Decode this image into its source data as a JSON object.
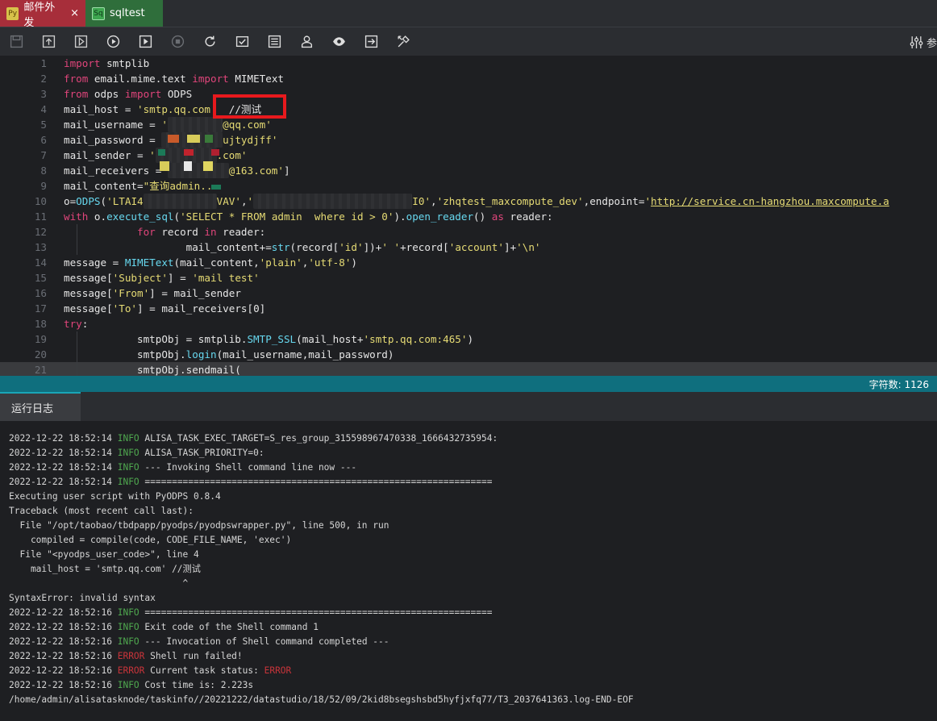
{
  "tabs": [
    {
      "icon": "Py",
      "label": "邮件外发",
      "close": "×"
    },
    {
      "icon": "Sq",
      "label": "sqltest"
    }
  ],
  "toolbar": {
    "right_label": "参"
  },
  "editor": {
    "lines": [
      {
        "n": "1",
        "parts": [
          [
            "kw",
            "import"
          ],
          [
            "",
            " smtplib"
          ]
        ]
      },
      {
        "n": "2",
        "parts": [
          [
            "kw",
            "from"
          ],
          [
            "",
            " email.mime.text "
          ],
          [
            "kw",
            "import"
          ],
          [
            "",
            " MIMEText"
          ]
        ]
      },
      {
        "n": "3",
        "parts": [
          [
            "kw",
            "from"
          ],
          [
            "",
            " odps "
          ],
          [
            "kw",
            "import"
          ],
          [
            "",
            " ODPS"
          ]
        ]
      },
      {
        "n": "4",
        "parts": [
          [
            "",
            "mail_host = "
          ],
          [
            "str",
            "'smtp.qq.com'"
          ],
          [
            "",
            "  //测试"
          ]
        ]
      },
      {
        "n": "5",
        "parts": [
          [
            "",
            "mail_username = "
          ],
          [
            "str",
            "'"
          ],
          [
            "blur",
            "         "
          ],
          [
            "str",
            "@qq.com'"
          ]
        ]
      },
      {
        "n": "6",
        "parts": [
          [
            "",
            "mail_password = "
          ],
          [
            "blur",
            "          "
          ],
          [
            "str",
            "ujtydjff'"
          ]
        ]
      },
      {
        "n": "7",
        "parts": [
          [
            "",
            "mail_sender = "
          ],
          [
            "str",
            "'"
          ],
          [
            "blur",
            "          "
          ],
          [
            "str",
            ".com'"
          ]
        ]
      },
      {
        "n": "8",
        "parts": [
          [
            "",
            "mail_receivers = "
          ],
          [
            "blur",
            "          "
          ],
          [
            "str",
            "@163.com'"
          ],
          [
            "",
            "]"
          ]
        ]
      },
      {
        "n": "9",
        "parts": [
          [
            "",
            "mail_content="
          ],
          [
            "str",
            "\"查询admin..."
          ]
        ]
      },
      {
        "n": "10",
        "parts": [
          [
            "",
            "o="
          ],
          [
            "fn",
            "ODPS"
          ],
          [
            "",
            "("
          ],
          [
            "str",
            "'LTAI4"
          ],
          [
            "blur",
            "            "
          ],
          [
            "str",
            "VAV'"
          ],
          [
            "",
            ","
          ],
          [
            "str",
            "'"
          ],
          [
            "blur",
            "                          "
          ],
          [
            "str",
            "I0'"
          ],
          [
            "",
            ","
          ],
          [
            "str",
            "'zhqtest_maxcompute_dev'"
          ],
          [
            "",
            ",endpoint="
          ],
          [
            "str",
            "'"
          ],
          [
            "url",
            "http://service.cn-hangzhou.maxcompute.a"
          ]
        ]
      },
      {
        "n": "11",
        "parts": [
          [
            "kw",
            "with"
          ],
          [
            "",
            " o."
          ],
          [
            "fn",
            "execute_sql"
          ],
          [
            "",
            "("
          ],
          [
            "str",
            "'SELECT * FROM admin  where id > 0'"
          ],
          [
            "",
            ")."
          ],
          [
            "fn",
            "open_reader"
          ],
          [
            "",
            "() "
          ],
          [
            "kw",
            "as"
          ],
          [
            "",
            " reader:"
          ]
        ]
      },
      {
        "n": "12",
        "parts": [
          [
            "",
            "            "
          ],
          [
            "kw",
            "for"
          ],
          [
            "",
            " record "
          ],
          [
            "kw",
            "in"
          ],
          [
            "",
            " reader:"
          ]
        ]
      },
      {
        "n": "13",
        "parts": [
          [
            "",
            "                    mail_content+="
          ],
          [
            "fn",
            "str"
          ],
          [
            "",
            "(record["
          ],
          [
            "str",
            "'id'"
          ],
          [
            "",
            "])+"
          ],
          [
            "str",
            "' '"
          ],
          [
            "",
            "+record["
          ],
          [
            "str",
            "'account'"
          ],
          [
            "",
            "]+"
          ],
          [
            "str",
            "'\\n'"
          ]
        ]
      },
      {
        "n": "14",
        "parts": [
          [
            "",
            "message = "
          ],
          [
            "fn",
            "MIMEText"
          ],
          [
            "",
            "(mail_content,"
          ],
          [
            "str",
            "'plain'"
          ],
          [
            "",
            ","
          ],
          [
            "str",
            "'utf-8'"
          ],
          [
            "",
            ")"
          ]
        ]
      },
      {
        "n": "15",
        "parts": [
          [
            "",
            "message["
          ],
          [
            "str",
            "'Subject'"
          ],
          [
            "",
            "] = "
          ],
          [
            "str",
            "'mail test'"
          ]
        ]
      },
      {
        "n": "16",
        "parts": [
          [
            "",
            "message["
          ],
          [
            "str",
            "'From'"
          ],
          [
            "",
            "] = mail_sender"
          ]
        ]
      },
      {
        "n": "17",
        "parts": [
          [
            "",
            "message["
          ],
          [
            "str",
            "'To'"
          ],
          [
            "",
            "] = mail_receivers[0]"
          ]
        ]
      },
      {
        "n": "18",
        "parts": [
          [
            "kw",
            "try"
          ],
          [
            "",
            ":"
          ]
        ]
      },
      {
        "n": "19",
        "parts": [
          [
            "",
            "            smtpObj = smtplib."
          ],
          [
            "fn",
            "SMTP_SSL"
          ],
          [
            "",
            "(mail_host+"
          ],
          [
            "str",
            "'smtp.qq.com:465'"
          ],
          [
            "",
            ")"
          ]
        ]
      },
      {
        "n": "20",
        "parts": [
          [
            "",
            "            smtpObj."
          ],
          [
            "fn",
            "login"
          ],
          [
            "",
            "(mail_username,mail_password)"
          ]
        ]
      },
      {
        "n": "21",
        "parts": [
          [
            "",
            "            smtpObj.sendmail("
          ]
        ]
      }
    ]
  },
  "status": {
    "char_count": "字符数: 1126"
  },
  "log": {
    "tab_label": "运行日志",
    "lines": [
      {
        "ts": "2022-12-22 18:52:14 ",
        "lvl": "INFO",
        "msg": " ALISA_TASK_EXEC_TARGET=S_res_group_315598967470338_1666432735954:"
      },
      {
        "ts": "2022-12-22 18:52:14 ",
        "lvl": "INFO",
        "msg": " ALISA_TASK_PRIORITY=0:"
      },
      {
        "ts": "2022-12-22 18:52:14 ",
        "lvl": "INFO",
        "msg": " --- Invoking Shell command line now ---"
      },
      {
        "ts": "2022-12-22 18:52:14 ",
        "lvl": "INFO",
        "msg": " ================================================================"
      },
      {
        "ts": "",
        "lvl": "",
        "msg": "Executing user script with PyODPS 0.8.4"
      },
      {
        "ts": "",
        "lvl": "",
        "msg": "Traceback (most recent call last):"
      },
      {
        "ts": "",
        "lvl": "",
        "msg": "  File \"/opt/taobao/tbdpapp/pyodps/pyodpswrapper.py\", line 500, in run"
      },
      {
        "ts": "",
        "lvl": "",
        "msg": "    compiled = compile(code, CODE_FILE_NAME, 'exec')"
      },
      {
        "ts": "",
        "lvl": "",
        "msg": "  File \"<pyodps_user_code>\", line 4"
      },
      {
        "ts": "",
        "lvl": "",
        "msg": "    mail_host = 'smtp.qq.com' //测试"
      },
      {
        "ts": "",
        "lvl": "",
        "msg": "                                ^"
      },
      {
        "ts": "",
        "lvl": "",
        "msg": "SyntaxError: invalid syntax"
      },
      {
        "ts": "2022-12-22 18:52:16 ",
        "lvl": "INFO",
        "msg": " ================================================================"
      },
      {
        "ts": "2022-12-22 18:52:16 ",
        "lvl": "INFO",
        "msg": " Exit code of the Shell command 1"
      },
      {
        "ts": "2022-12-22 18:52:16 ",
        "lvl": "INFO",
        "msg": " --- Invocation of Shell command completed ---"
      },
      {
        "ts": "2022-12-22 18:52:16 ",
        "lvl": "ERROR",
        "msg": " Shell run failed!"
      },
      {
        "ts": "2022-12-22 18:52:16 ",
        "lvl": "ERROR",
        "msg": " Current task status: ",
        "tail": "ERROR"
      },
      {
        "ts": "2022-12-22 18:52:16 ",
        "lvl": "INFO",
        "msg": " Cost time is: 2.223s"
      },
      {
        "ts": "",
        "lvl": "",
        "msg": "/home/admin/alisatasknode/taskinfo//20221222/datastudio/18/52/09/2kid8bsegshsbd5hyfjxfq77/T3_2037641363.log-END-EOF"
      }
    ]
  },
  "colors": {
    "active_tab": "#a72e3a",
    "second_tab": "#2f6e3b",
    "statusbar": "#0f6f7e",
    "highlight_box": "#e8191d",
    "info": "#4fa84f",
    "error": "#c8343a"
  },
  "icons": [
    "save-icon",
    "upload-icon",
    "save-run-icon",
    "run-icon",
    "run-params-icon",
    "stop-icon",
    "refresh-icon",
    "submit-icon",
    "format-icon",
    "user-icon",
    "preview-icon",
    "export-icon",
    "tools-icon",
    "settings-sliders-icon"
  ]
}
